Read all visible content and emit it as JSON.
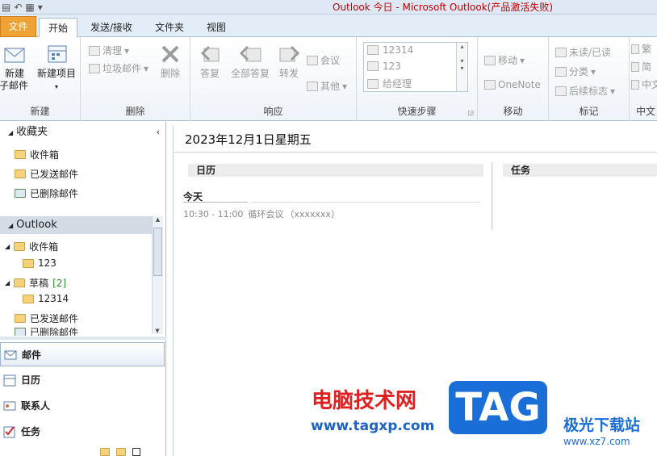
{
  "window": {
    "title": "Outlook 今日 - Microsoft Outlook(产品激活失败)"
  },
  "tabs": {
    "file": "文件",
    "home": "开始",
    "send_receive": "发送/接收",
    "folder": "文件夹",
    "view": "视图"
  },
  "ribbon": {
    "new": {
      "new_email_line1": "新建",
      "new_email_line2": "电子邮件",
      "new_items_line1": "新建项目",
      "label": "新建"
    },
    "delete": {
      "cleanup": "清理",
      "junk": "垃圾邮件",
      "delete": "删除",
      "label": "删除"
    },
    "respond": {
      "reply": "答复",
      "reply_all": "全部答复",
      "forward": "转发",
      "meeting": "会议",
      "more": "其他",
      "label": "响应"
    },
    "quick_steps": {
      "items": [
        "12314",
        "123",
        "给经理"
      ],
      "label": "快速步骤"
    },
    "move": {
      "move": "移动",
      "onenote": "OneNote",
      "label": "移动"
    },
    "tags": {
      "unread_read": "未读/已读",
      "categorize": "分类",
      "follow_up": "后续标志",
      "label": "标记"
    },
    "chinese": {
      "trad": "繁",
      "simp": "简",
      "convert": "中文",
      "label": "中文"
    }
  },
  "nav": {
    "favorites": "收藏夹",
    "fav_items": [
      "收件箱",
      "已发送邮件",
      "已删除邮件"
    ],
    "account": "Outlook",
    "inbox": "收件箱",
    "inbox_sub": "123",
    "drafts": "草稿",
    "drafts_count": "[2]",
    "drafts_sub": "12314",
    "sent": "已发送邮件",
    "deleted": "已删除邮件",
    "modules": [
      "邮件",
      "日历",
      "联系人",
      "任务"
    ]
  },
  "main": {
    "date_header": "2023年12月1日星期五",
    "calendar_header": "日历",
    "tasks_header": "任务",
    "today_label": "今天",
    "appointment_time": "10:30 - 11:00",
    "appointment_subject": "循环会议",
    "appointment_location": "（xxxxxxx）"
  },
  "watermark": {
    "line1": "电脑技术网",
    "line2": "www.tagxp.com",
    "tag": "TAG",
    "site": "极光下载站",
    "site_url": "www.xz7.com"
  }
}
